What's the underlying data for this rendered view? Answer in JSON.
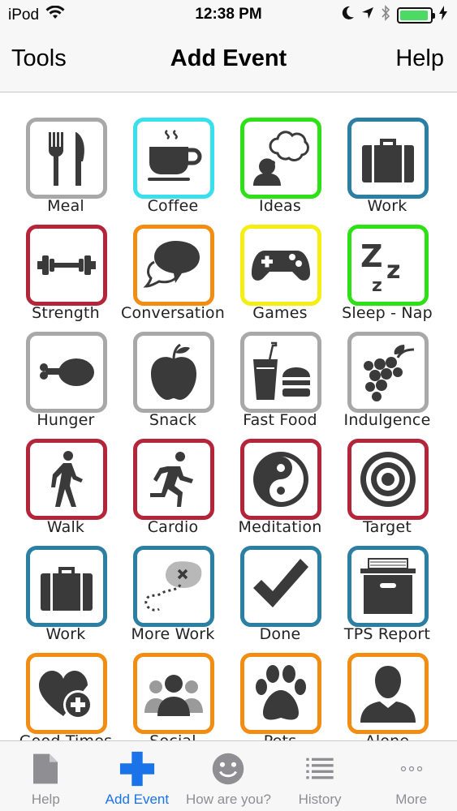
{
  "status": {
    "carrier": "iPod",
    "time": "12:38 PM",
    "battery_level": 0.95,
    "battery_color": "#4cd964"
  },
  "nav": {
    "left_label": "Tools",
    "title": "Add Event",
    "right_label": "Help"
  },
  "tiles": [
    {
      "label": "Meal",
      "icon": "fork-knife-icon",
      "color": "#a8a8a8"
    },
    {
      "label": "Coffee",
      "icon": "coffee-cup-icon",
      "color": "#37e0ec"
    },
    {
      "label": "Ideas",
      "icon": "thinking-head-icon",
      "color": "#2ee016"
    },
    {
      "label": "Work",
      "icon": "briefcase-icon",
      "color": "#2a7fa3"
    },
    {
      "label": "Strength",
      "icon": "dumbbell-icon",
      "color": "#b5253a"
    },
    {
      "label": "Conversation",
      "icon": "speech-bubbles-icon",
      "color": "#f28c12"
    },
    {
      "label": "Games",
      "icon": "gamepad-icon",
      "color": "#f4ee13"
    },
    {
      "label": "Sleep - Nap",
      "icon": "zzz-icon",
      "color": "#2ee016"
    },
    {
      "label": "Hunger",
      "icon": "drumstick-icon",
      "color": "#a8a8a8"
    },
    {
      "label": "Snack",
      "icon": "apple-icon",
      "color": "#a8a8a8"
    },
    {
      "label": "Fast Food",
      "icon": "fast-food-icon",
      "color": "#a8a8a8"
    },
    {
      "label": "Indulgence",
      "icon": "grapes-icon",
      "color": "#a8a8a8"
    },
    {
      "label": "Walk",
      "icon": "walking-person-icon",
      "color": "#b5253a"
    },
    {
      "label": "Cardio",
      "icon": "running-person-icon",
      "color": "#b5253a"
    },
    {
      "label": "Meditation",
      "icon": "yin-yang-icon",
      "color": "#b5253a"
    },
    {
      "label": "Target",
      "icon": "target-icon",
      "color": "#b5253a"
    },
    {
      "label": "Work",
      "icon": "briefcase-icon",
      "color": "#2a7fa3"
    },
    {
      "label": "More Work",
      "icon": "treasure-map-icon",
      "color": "#2a7fa3"
    },
    {
      "label": "Done",
      "icon": "checkmark-icon",
      "color": "#2a7fa3"
    },
    {
      "label": "TPS Report",
      "icon": "file-box-icon",
      "color": "#2a7fa3"
    },
    {
      "label": "Good Times",
      "icon": "heart-plus-icon",
      "color": "#f28c12"
    },
    {
      "label": "Social",
      "icon": "group-people-icon",
      "color": "#f28c12"
    },
    {
      "label": "Pets",
      "icon": "paw-print-icon",
      "color": "#f28c12"
    },
    {
      "label": "Alone",
      "icon": "single-person-icon",
      "color": "#f28c12"
    }
  ],
  "tabs": [
    {
      "label": "Help",
      "icon": "document-icon",
      "active": false
    },
    {
      "label": "Add Event",
      "icon": "plus-icon",
      "active": true
    },
    {
      "label": "How are you?",
      "icon": "smiley-icon",
      "active": false
    },
    {
      "label": "History",
      "icon": "list-icon",
      "active": false
    },
    {
      "label": "More",
      "icon": "more-dots-icon",
      "active": false
    }
  ],
  "colors": {
    "accent": "#1a73e8",
    "icon_fill": "#3a3a3a",
    "tab_inactive": "#8e8e93"
  }
}
